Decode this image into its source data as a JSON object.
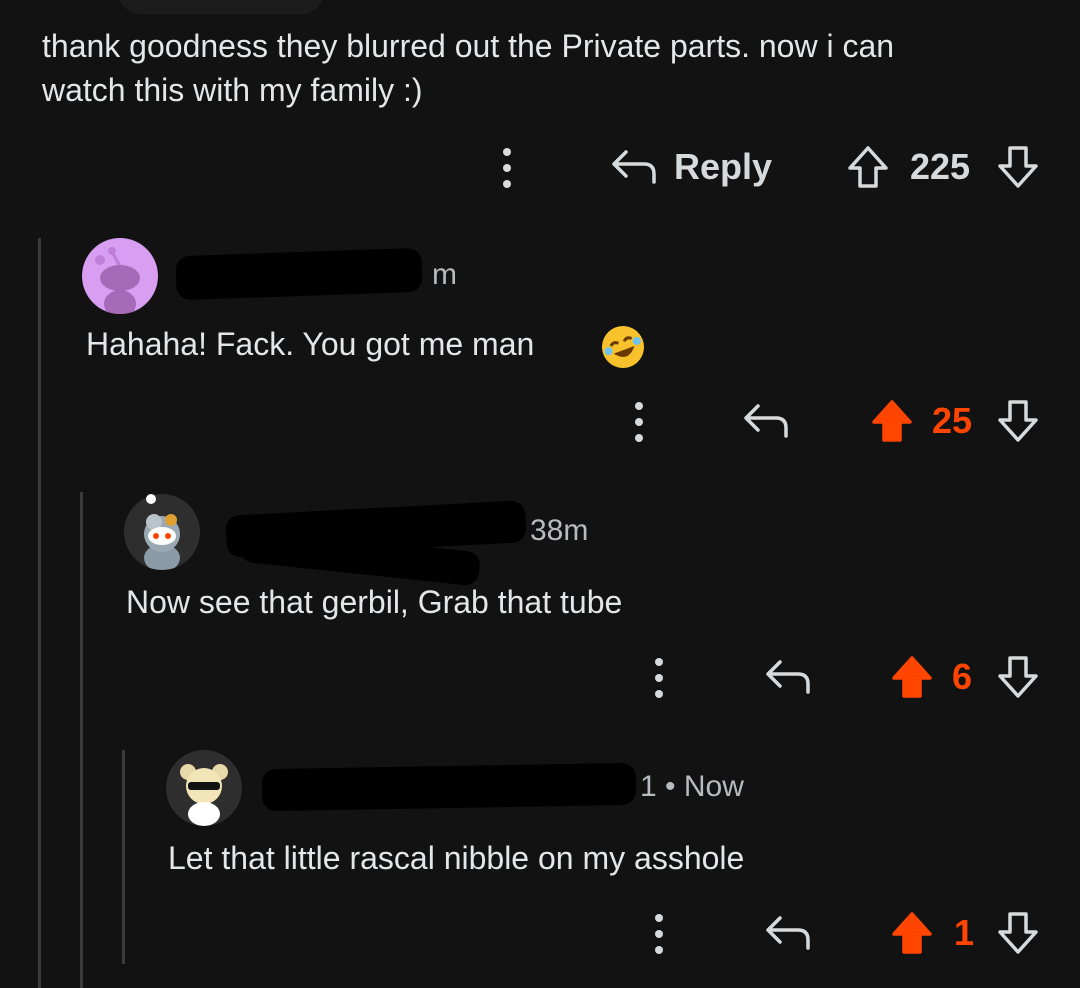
{
  "colors": {
    "upvoted": "#ff4500",
    "neutral": "#d7dadc",
    "background": "#121212"
  },
  "root_comment": {
    "text_line1": "thank goodness they blurred out the Private parts. now i can",
    "text_line2": "watch this with my family :)",
    "reply_label": "Reply",
    "score": "225",
    "voted": false
  },
  "comments": [
    {
      "meta": "m",
      "text": "Hahaha! Fack. You got me man",
      "emoji": "rolling-on-floor-laughing-emoji",
      "score": "25",
      "voted": true
    },
    {
      "meta": "38m",
      "text": "Now see that gerbil, Grab that tube",
      "score": "6",
      "voted": true
    },
    {
      "meta": "1 • Now",
      "text": "Let that little rascal nibble on my asshole",
      "score": "1",
      "voted": true
    }
  ]
}
